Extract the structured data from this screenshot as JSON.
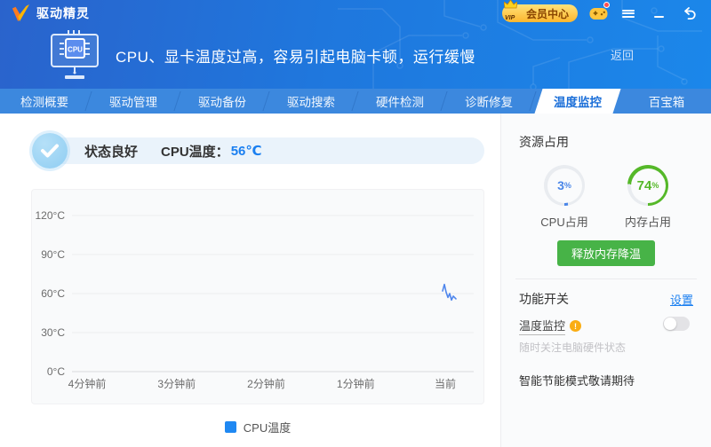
{
  "app": {
    "name": "驱动精灵",
    "titlebar": {
      "vip_button": "会员中心",
      "vip_tag": "VIP"
    }
  },
  "banner": {
    "headline": "CPU、显卡温度过高，容易引起电脑卡顿，运行缓慢",
    "back_link": "返回",
    "cpu_chip_label": "CPU"
  },
  "nav": {
    "tabs": [
      "检测概要",
      "驱动管理",
      "驱动备份",
      "驱动搜索",
      "硬件检测",
      "诊断修复",
      "温度监控",
      "百宝箱"
    ],
    "active": "温度监控"
  },
  "status": {
    "state": "状态良好",
    "temp_label": "CPU温度：",
    "temp_value": "56℃"
  },
  "chart_data": {
    "type": "line",
    "x_ticks": [
      "4分钟前",
      "3分钟前",
      "2分钟前",
      "1分钟前",
      "当前"
    ],
    "y_ticks": [
      0,
      30,
      60,
      90,
      120
    ],
    "y_unit": "°C",
    "ylim": [
      0,
      120
    ],
    "grid": true,
    "legend_position": "bottom",
    "legend": [
      {
        "name": "CPU温度",
        "color": "#1f88f2"
      }
    ],
    "series": [
      {
        "name": "CPU温度",
        "color": "#4f86ec",
        "x_as": "fraction_of_axis",
        "points": [
          [
            0.9225,
            62
          ],
          [
            0.927,
            67
          ],
          [
            0.9314,
            61
          ],
          [
            0.9358,
            57
          ],
          [
            0.9403,
            60
          ],
          [
            0.9447,
            55
          ],
          [
            0.9491,
            58
          ],
          [
            0.9558,
            56
          ]
        ]
      }
    ]
  },
  "sidebar": {
    "resource_title": "资源占用",
    "gauges": [
      {
        "value": "3",
        "unit": "%",
        "label": "CPU占用",
        "color": "#4a86e8",
        "track": "#e9ecf0"
      },
      {
        "value": "74",
        "unit": "%",
        "label": "内存占用",
        "color": "#55b829",
        "track": "#e9ecf0"
      }
    ],
    "release_button": "释放内存降温",
    "features": {
      "title": "功能开关",
      "settings_link": "设置",
      "toggle": {
        "label": "温度监控",
        "state": "off",
        "desc": "随时关注电脑硬件状态"
      },
      "coming_soon": "智能节能模式敬请期待"
    }
  },
  "colors": {
    "header_gradient_left": "#2a63cc",
    "header_gradient_right": "#1b87ea",
    "nav_bg": "#3c88de",
    "active_tab_text": "#1a6ed8",
    "accent_blue": "#1a7ff0",
    "button_green": "#47b347",
    "warning_orange": "#faad14",
    "line_blue": "#4f86ec"
  }
}
